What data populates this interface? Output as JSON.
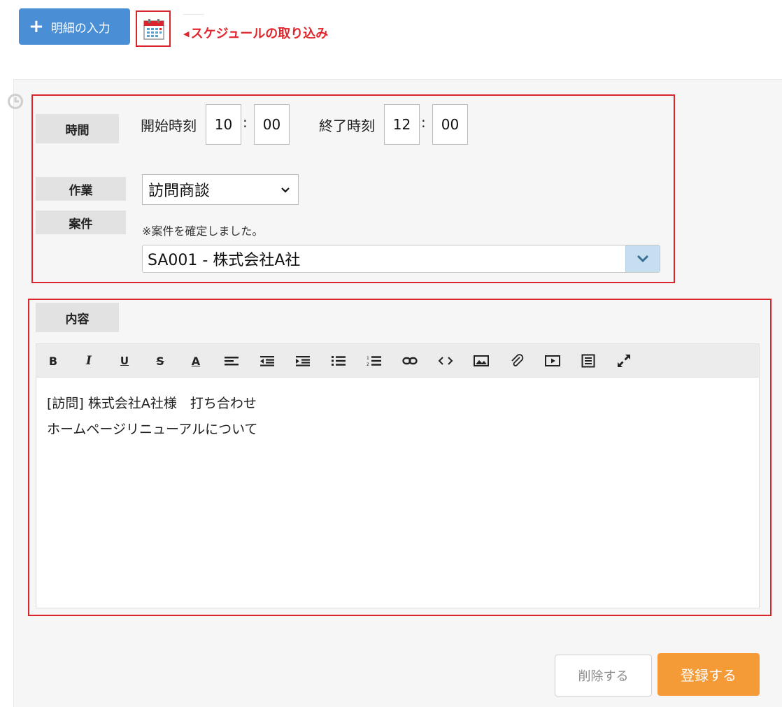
{
  "header": {
    "add_detail_label": "明細の入力",
    "schedule_import_label": "スケジュールの取り込み"
  },
  "form": {
    "time": {
      "label": "時間",
      "start_label": "開始時刻",
      "start_hour": "10",
      "start_minute": "00",
      "end_label": "終了時刻",
      "end_hour": "12",
      "end_minute": "00",
      "separator": ":"
    },
    "work": {
      "label": "作業",
      "selected": "訪問商談"
    },
    "case": {
      "label": "案件",
      "note": "※案件を確定しました。",
      "selected": "SA001 - 株式会社A社"
    },
    "content": {
      "label": "内容",
      "lines": [
        "[訪問] 株式会社A社様　打ち合わせ",
        "ホームページリニューアルについて"
      ]
    }
  },
  "editor_toolbar": [
    {
      "name": "bold-icon",
      "glyph": "B"
    },
    {
      "name": "italic-icon",
      "glyph": "I"
    },
    {
      "name": "underline-icon",
      "glyph": "U"
    },
    {
      "name": "strikethrough-icon",
      "glyph": "S"
    },
    {
      "name": "font-color-icon",
      "glyph": "A"
    },
    {
      "name": "align-left-icon"
    },
    {
      "name": "outdent-icon"
    },
    {
      "name": "indent-icon"
    },
    {
      "name": "bullet-list-icon"
    },
    {
      "name": "numbered-list-icon"
    },
    {
      "name": "link-icon"
    },
    {
      "name": "code-icon"
    },
    {
      "name": "image-icon"
    },
    {
      "name": "attachment-icon"
    },
    {
      "name": "video-icon"
    },
    {
      "name": "template-icon"
    },
    {
      "name": "fullscreen-icon"
    }
  ],
  "actions": {
    "delete_label": "削除する",
    "register_label": "登録する"
  },
  "colors": {
    "add_button": "#4a8fd6",
    "highlight": "#d9262c",
    "register_button": "#f49b38"
  }
}
